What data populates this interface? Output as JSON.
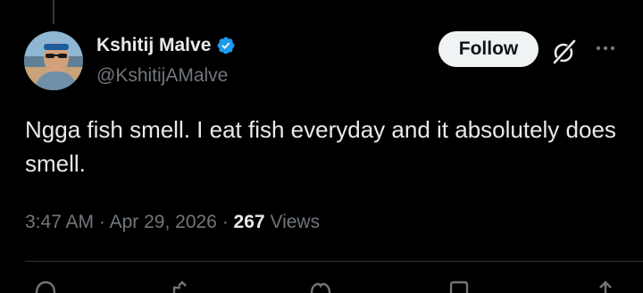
{
  "author": {
    "name": "Kshitij Malve",
    "handle": "@KshitijAMalve",
    "verified": true,
    "verified_color": "#1d9bf0"
  },
  "header": {
    "follow_label": "Follow",
    "grok_icon": "grok-icon",
    "more_icon": "more-icon"
  },
  "tweet": {
    "text": "Ngga fish smell. I eat fish everyday and it absolutely does smell."
  },
  "meta": {
    "time": "3:47 AM",
    "separator": "·",
    "date": "Apr 29, 2026",
    "views_count": "267",
    "views_label": "Views"
  },
  "actions": [
    "reply-icon",
    "repost-icon",
    "like-icon",
    "bookmark-icon",
    "share-icon"
  ],
  "colors": {
    "background": "#000000",
    "text": "#e7e9ea",
    "muted": "#71767b",
    "divider": "#2f3336",
    "button_bg": "#eff3f4"
  }
}
